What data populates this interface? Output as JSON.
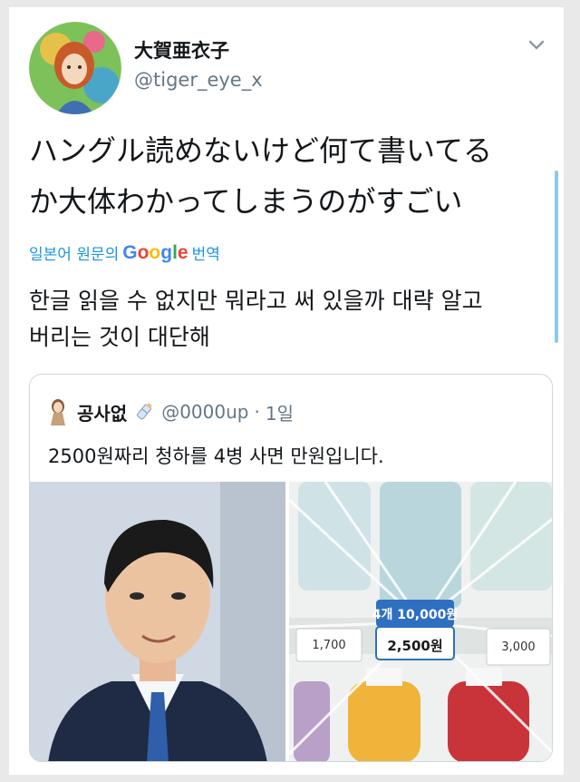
{
  "tweet": {
    "display_name": "大賀亜衣子",
    "handle": "@tiger_eye_x",
    "text_line1": "ハングル読めないけど何て書いてる",
    "text_line2": "か大体わかってしまうのがすごい",
    "translate_prefix": "일본어 원문의",
    "translate_brand": "Google",
    "translate_suffix": "번역",
    "translated_line1": "한글 읽을 수 없지만 뭐라고 써 있을까 대략 알고",
    "translated_line2": "버리는 것이 대단해"
  },
  "quoted": {
    "name": "공사없",
    "handle": "@0000up",
    "separator": "·",
    "time": "1일",
    "text": "2500원짜리 청하를 4병 사면 만원입니다.",
    "price_tag_big": {
      "line1": "4개 10,000원",
      "line2": "2,500원"
    },
    "price_tag_left": "1,700",
    "price_tag_right": "3,000"
  },
  "colors": {
    "link_blue": "#1b95e0",
    "text": "#14171a",
    "muted": "#657786",
    "google_blue": "#4285F4",
    "google_red": "#EA4335",
    "google_yellow": "#FBBC05",
    "google_green": "#34A853"
  },
  "icons": {
    "menu": "chevron-down-icon",
    "badge": "baby-bottle-icon"
  }
}
